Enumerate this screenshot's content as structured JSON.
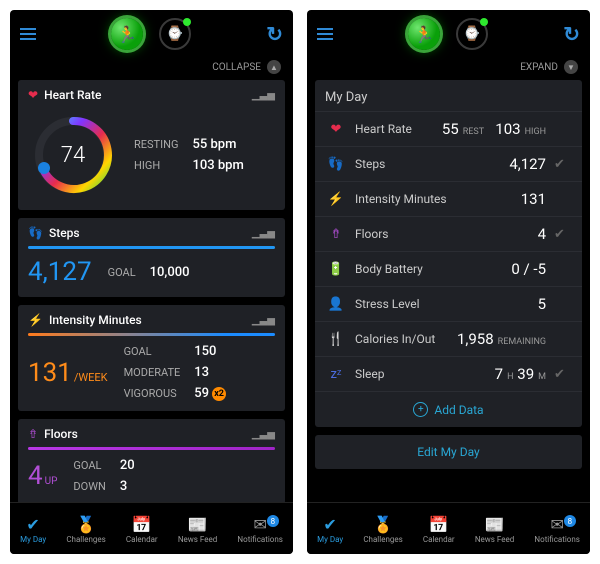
{
  "topbar": {},
  "collapse": {
    "label_left": "COLLAPSE",
    "label_right": "EXPAND"
  },
  "heart": {
    "title": "Heart Rate",
    "value": "74",
    "resting_label": "RESTING",
    "resting_value": "55 bpm",
    "high_label": "HIGH",
    "high_value": "103 bpm"
  },
  "steps": {
    "title": "Steps",
    "value": "4,127",
    "goal_label": "GOAL",
    "goal_value": "10,000"
  },
  "intensity": {
    "title": "Intensity Minutes",
    "value": "131",
    "suffix": "/WEEK",
    "goal_label": "GOAL",
    "goal_value": "150",
    "moderate_label": "MODERATE",
    "moderate_value": "13",
    "vigorous_label": "VIGOROUS",
    "vigorous_value": "59",
    "vigorous_mult": "x2"
  },
  "floors": {
    "title": "Floors",
    "value": "4",
    "suffix": "UP",
    "goal_label": "GOAL",
    "goal_value": "20",
    "down_label": "DOWN",
    "down_value": "3"
  },
  "compact": {
    "title": "My Day",
    "rows": {
      "heart": {
        "label": "Heart Rate",
        "v1": "55",
        "s1": "REST",
        "v2": "103",
        "s2": "HIGH"
      },
      "steps": {
        "label": "Steps",
        "value": "4,127"
      },
      "intensity": {
        "label": "Intensity Minutes",
        "value": "131"
      },
      "floors": {
        "label": "Floors",
        "value": "4"
      },
      "body": {
        "label": "Body Battery",
        "value": "0 / -5"
      },
      "stress": {
        "label": "Stress Level",
        "value": "5"
      },
      "calories": {
        "label": "Calories In/Out",
        "value": "1,958",
        "suffix": "REMAINING"
      },
      "sleep": {
        "label": "Sleep",
        "value_h": "7",
        "unit_h": "H",
        "value_m": "39",
        "unit_m": "M"
      }
    },
    "add": "Add Data",
    "edit": "Edit My Day"
  },
  "tabs": {
    "myday": "My Day",
    "challenges": "Challenges",
    "calendar": "Calendar",
    "newsfeed": "News Feed",
    "notifications": "Notifications",
    "badge_count": "8"
  }
}
